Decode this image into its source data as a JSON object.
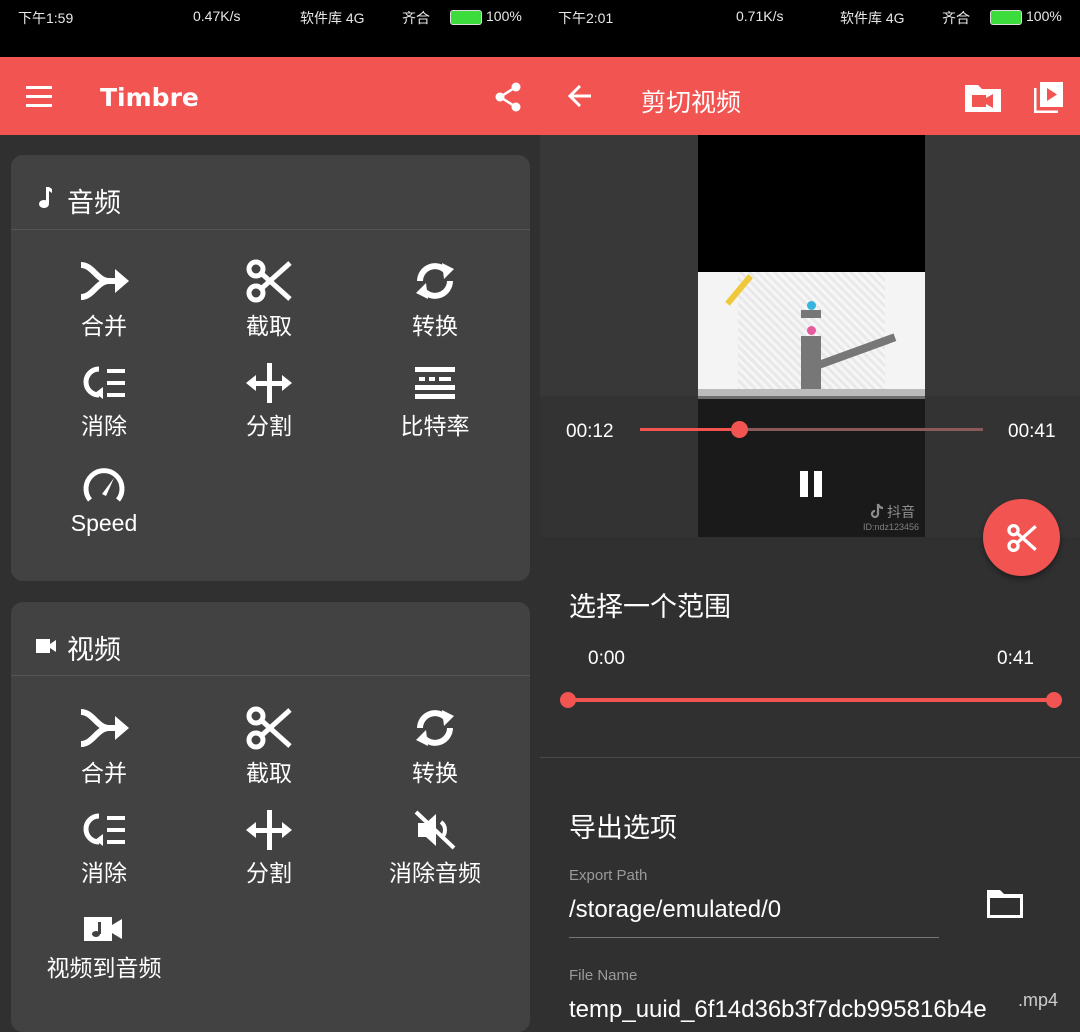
{
  "colors": {
    "accent": "#f25452",
    "card": "#424242",
    "bg": "#303030"
  },
  "left": {
    "status": {
      "time": "下午1:59",
      "speed": "0.47K/s",
      "carrier1": "软件库 4G",
      "carrier2": "齐合",
      "battery": "100%"
    },
    "appbar": {
      "title": "Timbre"
    },
    "audio_card": {
      "title": "音频",
      "tools": [
        {
          "label": "合并",
          "icon": "merge-icon"
        },
        {
          "label": "截取",
          "icon": "scissors-icon"
        },
        {
          "label": "转换",
          "icon": "convert-icon"
        },
        {
          "label": "消除",
          "icon": "remove-icon"
        },
        {
          "label": "分割",
          "icon": "split-icon"
        },
        {
          "label": "比特率",
          "icon": "bitrate-icon"
        },
        {
          "label": "Speed",
          "icon": "speed-icon"
        }
      ]
    },
    "video_card": {
      "title": "视频",
      "tools": [
        {
          "label": "合并",
          "icon": "merge-icon"
        },
        {
          "label": "截取",
          "icon": "scissors-icon"
        },
        {
          "label": "转换",
          "icon": "convert-icon"
        },
        {
          "label": "消除",
          "icon": "remove-icon"
        },
        {
          "label": "分割",
          "icon": "split-icon"
        },
        {
          "label": "消除音频",
          "icon": "mute-icon"
        },
        {
          "label": "视频到音频",
          "icon": "video-to-audio-icon"
        }
      ]
    }
  },
  "right": {
    "status": {
      "time": "下午2:01",
      "speed": "0.71K/s",
      "carrier1": "软件库 4G",
      "carrier2": "齐合",
      "battery": "100%"
    },
    "appbar": {
      "title": "剪切视频"
    },
    "player": {
      "current": "00:12",
      "total": "00:41",
      "progress": 0.29,
      "watermark": "抖音",
      "watermark_id": "ID:ndz123456"
    },
    "range": {
      "title": "选择一个范围",
      "start": "0:00",
      "end": "0:41"
    },
    "export": {
      "title": "导出选项",
      "path_hint": "Export Path",
      "path_value": "/storage/emulated/0",
      "name_hint": "File Name",
      "name_value": "temp_uuid_6f14d36b3f7dcb995816b4e",
      "extension": ".mp4"
    }
  }
}
